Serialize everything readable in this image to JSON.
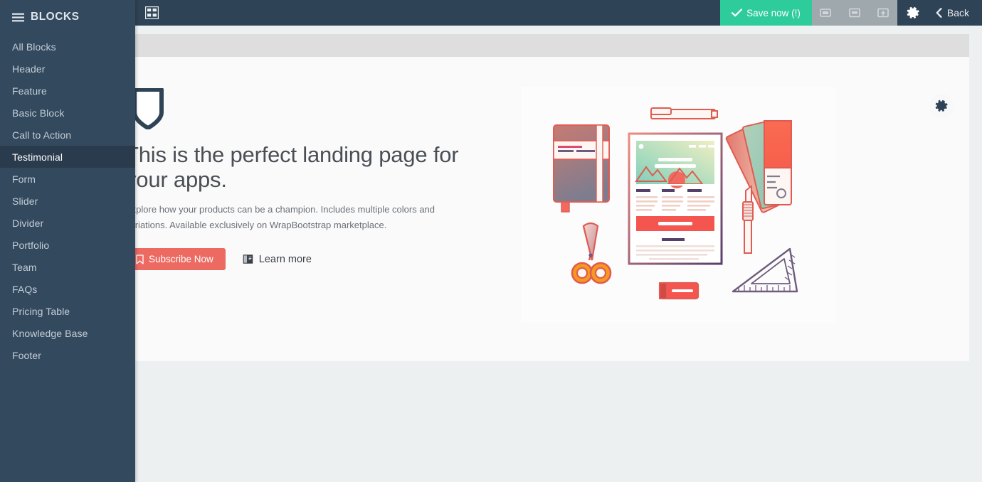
{
  "topbar": {
    "grid_icon": "grid-blocks-icon",
    "save_label": "Save now (!)",
    "save_check_icon": "check-icon",
    "save_color": "#2ecc9b",
    "devices": [
      {
        "name": "mobile-preview",
        "icon": "mobile-icon"
      },
      {
        "name": "tablet-preview",
        "icon": "tablet-icon"
      },
      {
        "name": "desktop-preview",
        "icon": "desktop-icon"
      }
    ],
    "device_group_bg": "#9fa8ad",
    "settings_icon": "gear-icon",
    "back_label": "Back",
    "back_icon": "chevron-left-icon",
    "bg_color": "#2f4356"
  },
  "sidebar": {
    "title": "BLOCKS",
    "menu_icon": "hamburger-icon",
    "bg_color": "#33495e",
    "active_bg_color": "#2a3b4d",
    "items": [
      {
        "label": "All Blocks",
        "active": false
      },
      {
        "label": "Header",
        "active": false
      },
      {
        "label": "Feature",
        "active": false
      },
      {
        "label": "Basic Block",
        "active": false
      },
      {
        "label": "Call to Action",
        "active": false
      },
      {
        "label": "Testimonial",
        "active": true
      },
      {
        "label": "Form",
        "active": false
      },
      {
        "label": "Slider",
        "active": false
      },
      {
        "label": "Divider",
        "active": false
      },
      {
        "label": "Portfolio",
        "active": false
      },
      {
        "label": "Team",
        "active": false
      },
      {
        "label": "FAQs",
        "active": false
      },
      {
        "label": "Pricing Table",
        "active": false
      },
      {
        "label": "Knowledge Base",
        "active": false
      },
      {
        "label": "Footer",
        "active": false
      }
    ]
  },
  "canvas": {
    "bg_color": "#ecf0f1",
    "panel_bg_color": "#fafafa",
    "gray_band_color": "#dededf",
    "panel_settings_icon": "gear-icon"
  },
  "hero": {
    "badge_icon": "shield-icon",
    "heading": "This is the perfect landing page for your apps.",
    "paragraph": "Explore how your products can be a champion. Includes multiple colors and variations. Available exclusively on WrapBootstrap marketplace.",
    "primary_button": {
      "label": "Subscribe Now",
      "icon": "bookmark-icon",
      "color": "#ec6a62"
    },
    "secondary_button": {
      "label": "Learn more",
      "icon": "book-icon"
    },
    "illustration": "design-tools-illustration"
  }
}
